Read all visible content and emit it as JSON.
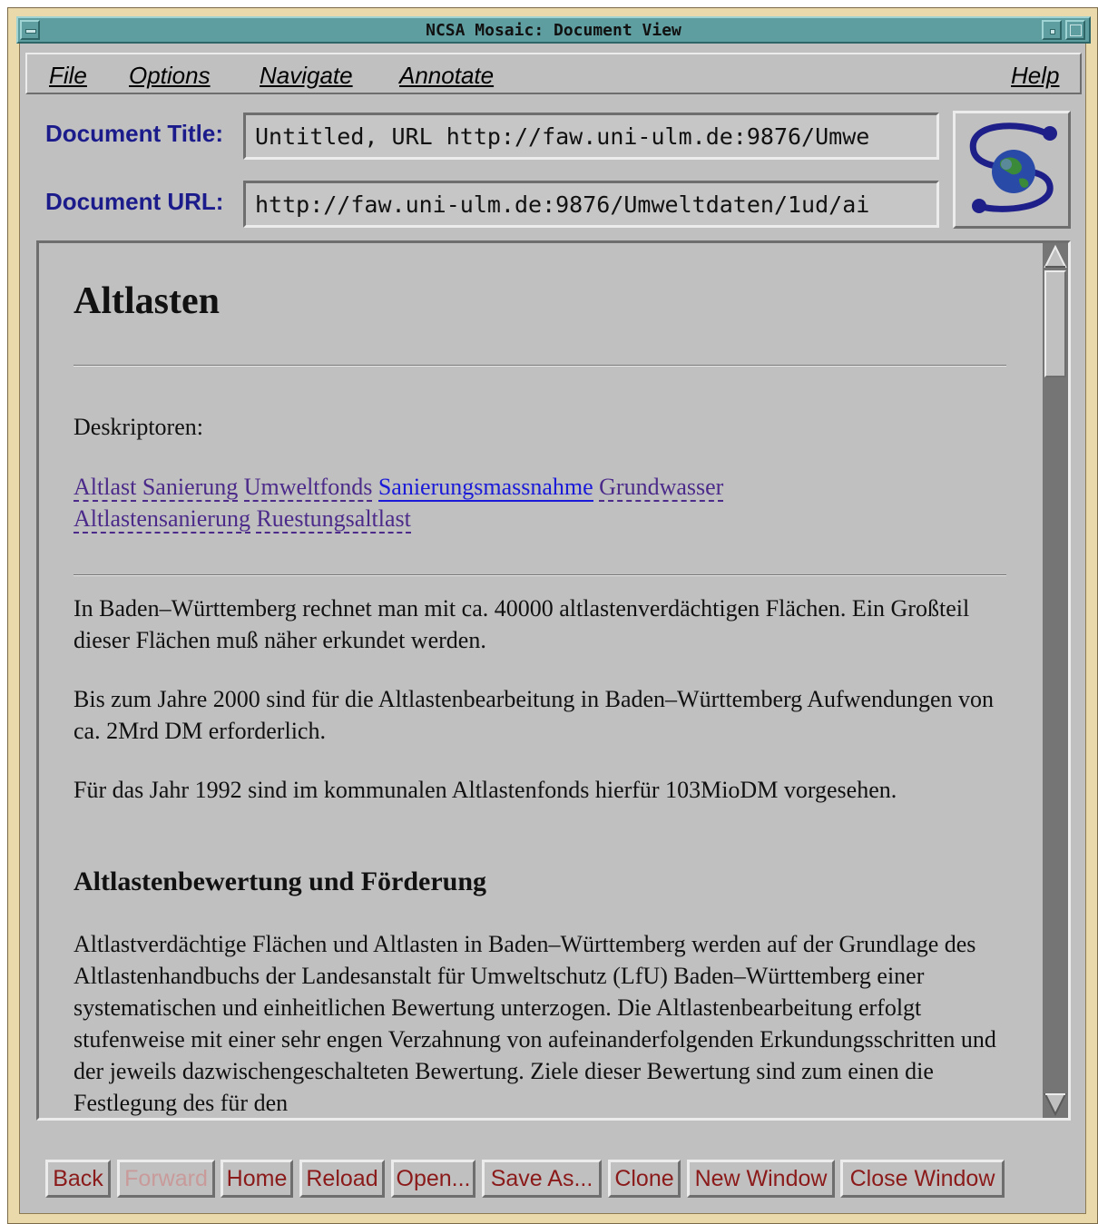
{
  "window": {
    "title": "NCSA Mosaic: Document View"
  },
  "menubar": {
    "file": "File",
    "options": "Options",
    "navigate": "Navigate",
    "annotate": "Annotate",
    "help": "Help"
  },
  "fields": {
    "title_label": "Document Title:",
    "title_value": "Untitled, URL http://faw.uni-ulm.de:9876/Umwe",
    "url_label": "Document URL:",
    "url_value": "http://faw.uni-ulm.de:9876/Umweltdaten/1ud/ai"
  },
  "document": {
    "heading": "Altlasten",
    "descriptor_label": "Deskriptoren:",
    "links": [
      "Altlast",
      "Sanierung",
      "Umweltfonds",
      "Sanierungsmassnahme",
      "Grundwasser",
      "Altlastensanierung",
      "Ruestungsaltlast"
    ],
    "para1": "In Baden–Württemberg rechnet man mit ca. 40000 altlastenverdächtigen Flächen. Ein Großteil dieser Flächen muß näher erkundet werden.",
    "para2": "Bis zum Jahre 2000 sind für die Altlastenbearbeitung in Baden–Württemberg Aufwendungen von ca. 2Mrd DM erforderlich.",
    "para3": "Für das Jahr 1992 sind im kommunalen Altlastenfonds hierfür 103MioDM vorgesehen.",
    "subheading": "Altlastenbewertung und Förderung",
    "para4": "Altlastverdächtige Flächen und Altlasten in Baden–Württemberg werden auf der Grundlage des Altlastenhandbuchs der Landesanstalt für Umweltschutz (LfU) Baden–Württemberg einer systematischen und einheitlichen Bewertung unterzogen. Die Altlastenbearbeitung erfolgt stufenweise mit einer sehr engen Verzahnung von aufeinanderfolgenden Erkundungsschritten und der jeweils dazwischengeschalteten Bewertung. Ziele dieser Bewertung sind zum einen die Festlegung des für den"
  },
  "buttons": {
    "back": "Back",
    "forward": "Forward",
    "home": "Home",
    "reload": "Reload",
    "open": "Open...",
    "save_as": "Save As...",
    "clone": "Clone",
    "new_window": "New Window",
    "close_window": "Close Window"
  },
  "colors": {
    "titlebar": "#5f9ea0",
    "frame": "#ead9aa",
    "panel": "#c0c0c0",
    "label": "#1b1b8c",
    "link": "#4b2a8a",
    "link_active": "#1a1ad8",
    "button_text": "#8b1a1a"
  },
  "icons": {
    "logo": "mosaic-globe-logo",
    "scroll_up": "triangle-up-icon",
    "scroll_down": "triangle-down-icon"
  }
}
